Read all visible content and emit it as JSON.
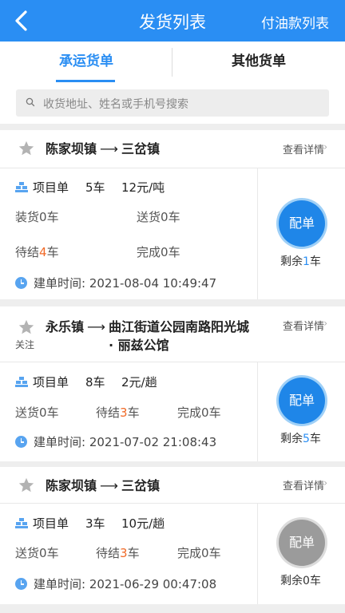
{
  "header": {
    "title": "发货列表",
    "right_link": "付油款列表"
  },
  "tabs": [
    {
      "label": "承运货单"
    },
    {
      "label": "其他货单"
    }
  ],
  "search": {
    "placeholder": "收货地址、姓名或手机号搜索"
  },
  "cards": [
    {
      "origin": "陈家坝镇",
      "dest": "三岔镇",
      "follow": "",
      "detail": "查看详情",
      "project_label": "项目单",
      "trucks": "5车",
      "price": "12元/吨",
      "stats": [
        {
          "label": "装货",
          "value": "0",
          "unit": "车",
          "highlight": false
        },
        {
          "label": "送货",
          "value": "0",
          "unit": "车",
          "highlight": false
        },
        {
          "label": "待结",
          "value": "4",
          "unit": "车",
          "highlight": true
        },
        {
          "label": "完成",
          "value": "0",
          "unit": "车",
          "highlight": false
        }
      ],
      "time_label": "建单时间: 2021-08-04 10:49:47",
      "dispatch_label": "配单",
      "dispatch_active": true,
      "remain_prefix": "剩余",
      "remain_value": "1",
      "remain_unit": "车"
    },
    {
      "origin": "永乐镇",
      "dest_line1": "曲江街道公园南路阳光城",
      "dest_line2": "· 丽兹公馆",
      "follow": "关注",
      "detail": "查看详情",
      "project_label": "项目单",
      "trucks": "8车",
      "price": "2元/趟",
      "stats": [
        {
          "label": "送货",
          "value": "0",
          "unit": "车",
          "highlight": false
        },
        {
          "label": "待结",
          "value": "3",
          "unit": "车",
          "highlight": true
        },
        {
          "label": "完成",
          "value": "0",
          "unit": "车",
          "highlight": false
        }
      ],
      "time_label": "建单时间: 2021-07-02 21:08:43",
      "dispatch_label": "配单",
      "dispatch_active": true,
      "remain_prefix": "剩余",
      "remain_value": "5",
      "remain_unit": "车"
    },
    {
      "origin": "陈家坝镇",
      "dest": "三岔镇",
      "follow": "",
      "detail": "查看详情",
      "project_label": "项目单",
      "trucks": "3车",
      "price": "10元/趟",
      "stats": [
        {
          "label": "送货",
          "value": "0",
          "unit": "车",
          "highlight": false
        },
        {
          "label": "待结",
          "value": "3",
          "unit": "车",
          "highlight": true
        },
        {
          "label": "完成",
          "value": "0",
          "unit": "车",
          "highlight": false
        }
      ],
      "time_label": "建单时间: 2021-06-29 00:47:08",
      "dispatch_label": "配单",
      "dispatch_active": false,
      "remain_prefix": "剩余",
      "remain_value": "0",
      "remain_unit": "车"
    }
  ],
  "colors": {
    "primary": "#2a8ef3",
    "highlight": "#f06a28",
    "disabled": "#9b9b9b"
  },
  "icons": {
    "back": "chevron-left-icon",
    "search": "search-icon",
    "star": "star-icon",
    "project": "stack-icon",
    "clock": "clock-icon"
  }
}
